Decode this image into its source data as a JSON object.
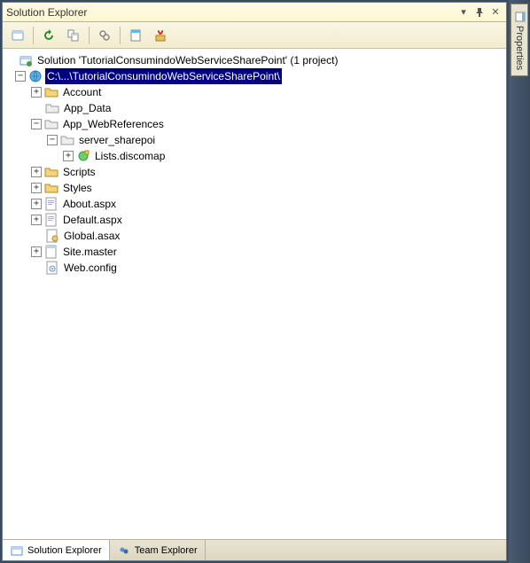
{
  "window": {
    "title": "Solution Explorer"
  },
  "toolbar": {
    "buttons": [
      "home-icon",
      "refresh-icon",
      "link-icon",
      "show-all-icon",
      "properties-icon",
      "view-code-icon"
    ]
  },
  "tree": {
    "solution_prefix": "Solution '",
    "solution_name": "TutorialConsumindoWebServiceSharePoint",
    "solution_suffix": "' (1 project)",
    "project_label": "C:\\...\\TutorialConsumindoWebServiceSharePoint\\",
    "nodes": {
      "account": "Account",
      "app_data": "App_Data",
      "app_webrefs": "App_WebReferences",
      "server_sharepoi": "server_sharepoi",
      "lists_discomap": "Lists.discomap",
      "scripts": "Scripts",
      "styles": "Styles",
      "about": "About.aspx",
      "default": "Default.aspx",
      "global": "Global.asax",
      "sitemaster": "Site.master",
      "webconfig": "Web.config"
    }
  },
  "tabs": {
    "solution_explorer": "Solution Explorer",
    "team_explorer": "Team Explorer"
  },
  "side": {
    "properties": "Properties"
  }
}
